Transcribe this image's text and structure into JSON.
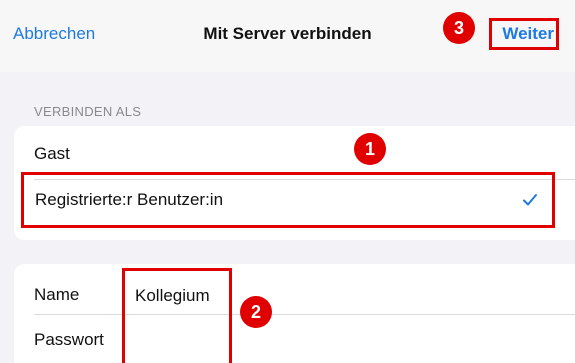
{
  "navbar": {
    "cancel_label": "Abbrechen",
    "title": "Mit Server verbinden",
    "next_label": "Weiter"
  },
  "connect_as": {
    "header": "VERBINDEN ALS",
    "options": [
      {
        "label": "Gast",
        "selected": false
      },
      {
        "label": "Registrierte:r Benutzer:in",
        "selected": true
      }
    ]
  },
  "credentials": {
    "name_label": "Name",
    "name_value": "Kollegium",
    "password_label": "Passwort",
    "password_value": ""
  },
  "markers": [
    "1",
    "2",
    "3"
  ],
  "colors": {
    "accent": "#1f7ae0",
    "highlight": "#e00000",
    "background": "#f2f2f7"
  },
  "icons": {
    "selected": "checkmark-icon"
  }
}
